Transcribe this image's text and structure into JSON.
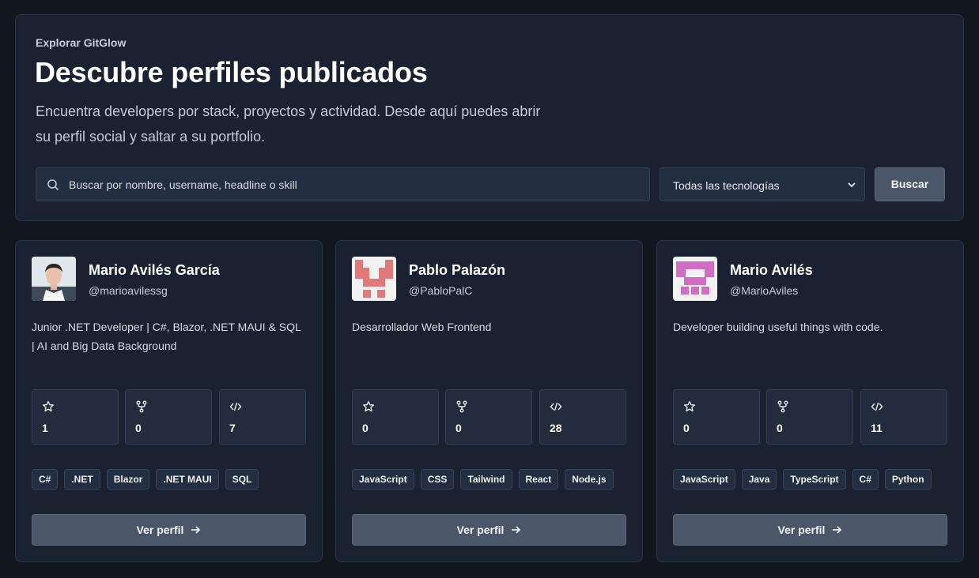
{
  "hero": {
    "eyebrow": "Explorar GitGlow",
    "title": "Descubre perfiles publicados",
    "subtitle": "Encuentra developers por stack, proyectos y actividad. Desde aquí puedes abrir su perfil social y saltar a su portfolio.",
    "search_placeholder": "Buscar por nombre, username, headline o skill",
    "select_value": "Todas las tecnologías",
    "search_button": "Buscar"
  },
  "icons": {
    "search": "search-icon",
    "chevron": "chevron-down-icon",
    "star": "star-icon",
    "fork": "fork-icon",
    "code": "code-icon",
    "arrow": "arrow-right-icon"
  },
  "cards": [
    {
      "name": "Mario Avilés García",
      "username": "@marioavilessg",
      "headline": "Junior .NET Developer | C#, Blazor, .NET MAUI & SQL | AI and Big Data Background",
      "stars": "1",
      "forks": "0",
      "repos": "7",
      "tags": [
        "C#",
        ".NET",
        "Blazor",
        ".NET MAUI",
        "SQL"
      ],
      "button": "Ver perfil"
    },
    {
      "name": "Pablo Palazón",
      "username": "@PabloPalC",
      "headline": "Desarrollador Web Frontend",
      "stars": "0",
      "forks": "0",
      "repos": "28",
      "tags": [
        "JavaScript",
        "CSS",
        "Tailwind",
        "React",
        "Node.js"
      ],
      "button": "Ver perfil",
      "identicon_color": "#e07a7a"
    },
    {
      "name": "Mario Avilés",
      "username": "@MarioAviles",
      "headline": "Developer building useful things with code.",
      "stars": "0",
      "forks": "0",
      "repos": "11",
      "tags": [
        "JavaScript",
        "Java",
        "TypeScript",
        "C#",
        "Python"
      ],
      "button": "Ver perfil",
      "identicon_color": "#d06fc2"
    }
  ]
}
